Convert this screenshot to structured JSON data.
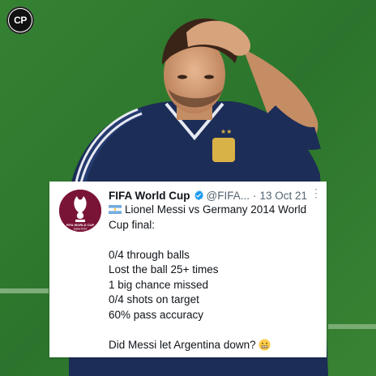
{
  "watermark": {
    "label": "CP"
  },
  "colors": {
    "grass_dark": "#2f7a2f",
    "grass_light": "#4f9a45",
    "jersey": "#1c2d57",
    "fifa_maroon": "#7a1437",
    "twitter_blue": "#1d9bf0"
  },
  "tweet": {
    "author_name": "FIFA World Cup",
    "handle": "@FIFA...",
    "separator": "·",
    "date": "13 Oct 21",
    "more_glyph": "⋮",
    "avatar_text": "FIFA WORLD CUP Qatar2022",
    "lines": {
      "l1": "Lionel Messi vs Germany 2014 World",
      "l2": "Cup final:",
      "s1": "0/4 through balls",
      "s2": "Lost the ball 25+ times",
      "s3": "1 big chance missed",
      "s4": "0/4 shots on target",
      "s5": "60% pass accuracy",
      "question": "Did Messi let Argentina down?"
    },
    "icons": {
      "flag": "argentina-flag-icon",
      "emoji": "grimacing-face-emoji-icon",
      "verified": "verified-badge-icon"
    }
  }
}
